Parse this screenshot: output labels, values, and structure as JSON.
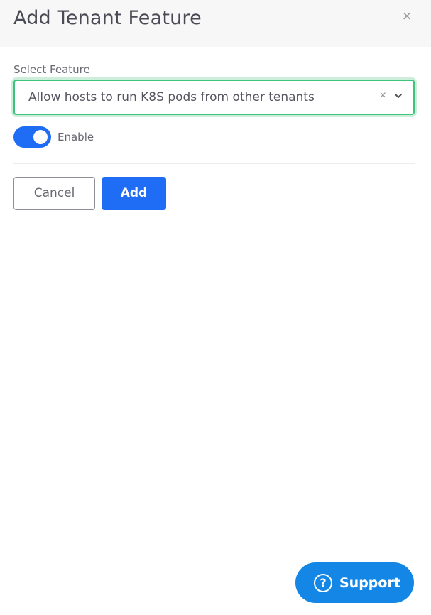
{
  "dialog": {
    "title": "Add Tenant Feature",
    "close_icon": "close-icon"
  },
  "feature_select": {
    "label": "Select Feature",
    "value": "Allow hosts to run K8S pods from other tenants",
    "clear_glyph": "×",
    "focused": true
  },
  "enable_toggle": {
    "label": "Enable",
    "checked": true
  },
  "actions": {
    "cancel_label": "Cancel",
    "add_label": "Add"
  },
  "support": {
    "label": "Support",
    "icon_glyph": "?"
  },
  "colors": {
    "accent": "#1f6cf5",
    "focus_border": "#3cc47c",
    "support_bg": "#1487e6"
  }
}
